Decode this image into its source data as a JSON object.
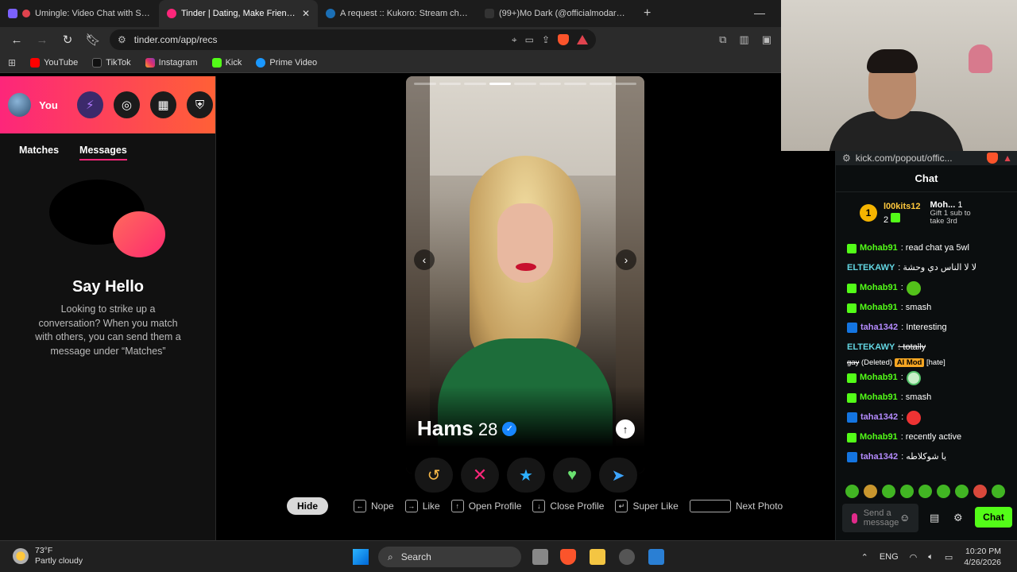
{
  "browser": {
    "tabs": [
      {
        "title": "Umingle: Video Chat with Strange",
        "active": false,
        "color": "#7b61ff"
      },
      {
        "title": "Tinder | Dating, Make Friends & ",
        "active": true,
        "color": "#fd267a"
      },
      {
        "title": "A request :: Kukoro: Stream chat gam",
        "active": false,
        "color": "#1b6fb5"
      },
      {
        "title": "(99+)Mo Dark (@officialmodark) | Tik",
        "active": false,
        "color": "#111111"
      }
    ],
    "url": "tinder.com/app/recs",
    "bookmarks": [
      "YouTube",
      "TikTok",
      "Instagram",
      "Kick",
      "Prime Video"
    ]
  },
  "sidebar": {
    "you_label": "You",
    "tabs": [
      "Matches",
      "Messages"
    ],
    "title": "Say Hello",
    "description": "Looking to strike up a conversation? When you match with others, you can send them a message under “Matches”"
  },
  "card": {
    "name": "Hams",
    "age": "28",
    "photo_count": 9,
    "current_photo": 4
  },
  "shortcuts": {
    "hide": "Hide",
    "items": [
      "Nope",
      "Like",
      "Open Profile",
      "Close Profile",
      "Super Like",
      "Next Photo"
    ]
  },
  "chat": {
    "url": "kick.com/popout/offic...",
    "title": "Chat",
    "pinned": {
      "rank": "1",
      "user": "l00kits12",
      "count": "2",
      "user2": "Moh...",
      "count2": "1",
      "gift": "Gift 1 sub to take 3rd"
    },
    "messages": [
      {
        "user": "Mohab91",
        "text": ": read chat ya 5wl",
        "color": "green"
      },
      {
        "user": "ELTEKAWY",
        "text": ": لا لا الناس دي وحشة",
        "color": "teal"
      },
      {
        "user": "Mohab91",
        "text": ":",
        "color": "green"
      },
      {
        "user": "Mohab91",
        "text": ": smash",
        "color": "green"
      },
      {
        "user": "taha1342",
        "text": ": Interesting",
        "color": "purple"
      },
      {
        "user": "ELTEKAWY",
        "text": ": totally",
        "color": "teal"
      },
      {
        "user": "Mohab91",
        "text": ":",
        "color": "green"
      },
      {
        "user": "Mohab91",
        "text": ": smash",
        "color": "green"
      },
      {
        "user": "taha1342",
        "text": ":",
        "color": "purple"
      },
      {
        "user": "Mohab91",
        "text": ": recently active",
        "color": "green"
      },
      {
        "user": "taha1342",
        "text": ": يا شوكلاطه",
        "color": "purple"
      }
    ],
    "deleted_line": {
      "word": "gay",
      "deleted": "(Deleted)",
      "mod": "AI Mod",
      "reason": "[hate]"
    },
    "input_placeholder": "Send a message",
    "send_label": "Chat"
  },
  "taskbar": {
    "temp": "73°F",
    "weather": "Partly cloudy",
    "search": "Search",
    "lang": "ENG",
    "time": "10:20 PM",
    "date": "4/26/2026"
  }
}
